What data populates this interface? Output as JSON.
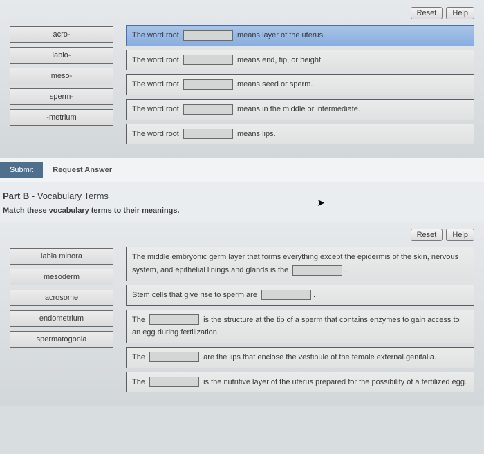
{
  "toolbar": {
    "reset": "Reset",
    "help": "Help"
  },
  "partA": {
    "terms": [
      "acro-",
      "labio-",
      "meso-",
      "sperm-",
      "-metrium"
    ],
    "targets": [
      {
        "pre": "The word root",
        "post": "means layer of the uterus."
      },
      {
        "pre": "The word root",
        "post": "means end, tip, or height."
      },
      {
        "pre": "The word root",
        "post": "means seed or sperm."
      },
      {
        "pre": "The word root",
        "post": "means in the middle or intermediate."
      },
      {
        "pre": "The word root",
        "post": "means lips."
      }
    ]
  },
  "submit": {
    "label": "Submit",
    "request": "Request Answer"
  },
  "partB": {
    "title_bold": "Part B",
    "title_rest": " - Vocabulary Terms",
    "instruction": "Match these vocabulary terms to their meanings.",
    "terms": [
      "labia minora",
      "mesoderm",
      "acrosome",
      "endometrium",
      "spermatogonia"
    ],
    "targets": [
      {
        "pre": "The middle embryonic germ layer that forms everything except the epidermis of the skin, nervous system, and epithelial linings and glands is the",
        "post": "."
      },
      {
        "pre": "Stem cells that give rise to sperm are",
        "post": "."
      },
      {
        "pre": "The",
        "post": "is the structure at the tip of a sperm that contains enzymes to gain access to an egg during fertilization."
      },
      {
        "pre": "The",
        "post": "are the lips that enclose the vestibule of the female external genitalia."
      },
      {
        "pre": "The",
        "post": "is the nutritive layer of the uterus prepared for the possibility of a fertilized egg."
      }
    ]
  }
}
